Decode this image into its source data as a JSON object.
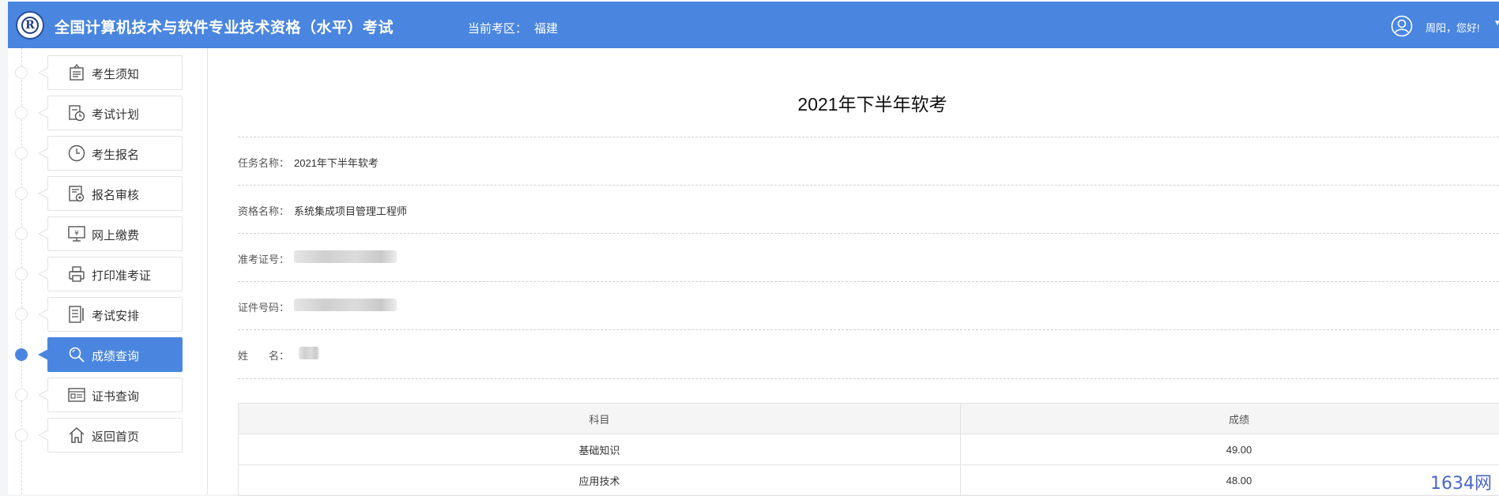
{
  "header": {
    "title": "全国计算机技术与软件专业技术资格（水平）考试",
    "region_label": "当前考区：",
    "region_value": "福建",
    "greeting": "周阳，您好!",
    "logo_text": "R"
  },
  "sidebar": {
    "items": [
      {
        "label": "考生须知",
        "icon": "notice-board-icon",
        "active": false
      },
      {
        "label": "考试计划",
        "icon": "calendar-clock-icon",
        "active": false
      },
      {
        "label": "考生报名",
        "icon": "clock-icon",
        "active": false
      },
      {
        "label": "报名审核",
        "icon": "review-document-icon",
        "active": false
      },
      {
        "label": "网上缴费",
        "icon": "monitor-yuan-icon",
        "active": false
      },
      {
        "label": "打印准考证",
        "icon": "printer-icon",
        "active": false
      },
      {
        "label": "考试安排",
        "icon": "document-pen-icon",
        "active": false
      },
      {
        "label": "成绩查询",
        "icon": "search-icon",
        "active": true
      },
      {
        "label": "证书查询",
        "icon": "certificate-icon",
        "active": false
      },
      {
        "label": "返回首页",
        "icon": "home-icon",
        "active": false
      }
    ]
  },
  "main": {
    "title": "2021年下半年软考",
    "fields": {
      "task_label": "任务名称：",
      "task_value": "2021年下半年软考",
      "qualification_label": "资格名称：",
      "qualification_value": "系统集成项目管理工程师",
      "admission_label": "准考证号：",
      "id_label": "证件号码：",
      "name_label": "姓　　名："
    },
    "table": {
      "headers": [
        "科目",
        "成绩"
      ],
      "rows": [
        [
          "基础知识",
          "49.00"
        ],
        [
          "应用技术",
          "48.00"
        ]
      ]
    }
  },
  "watermark": "1634网",
  "colors": {
    "brand": "#4a86e0"
  }
}
